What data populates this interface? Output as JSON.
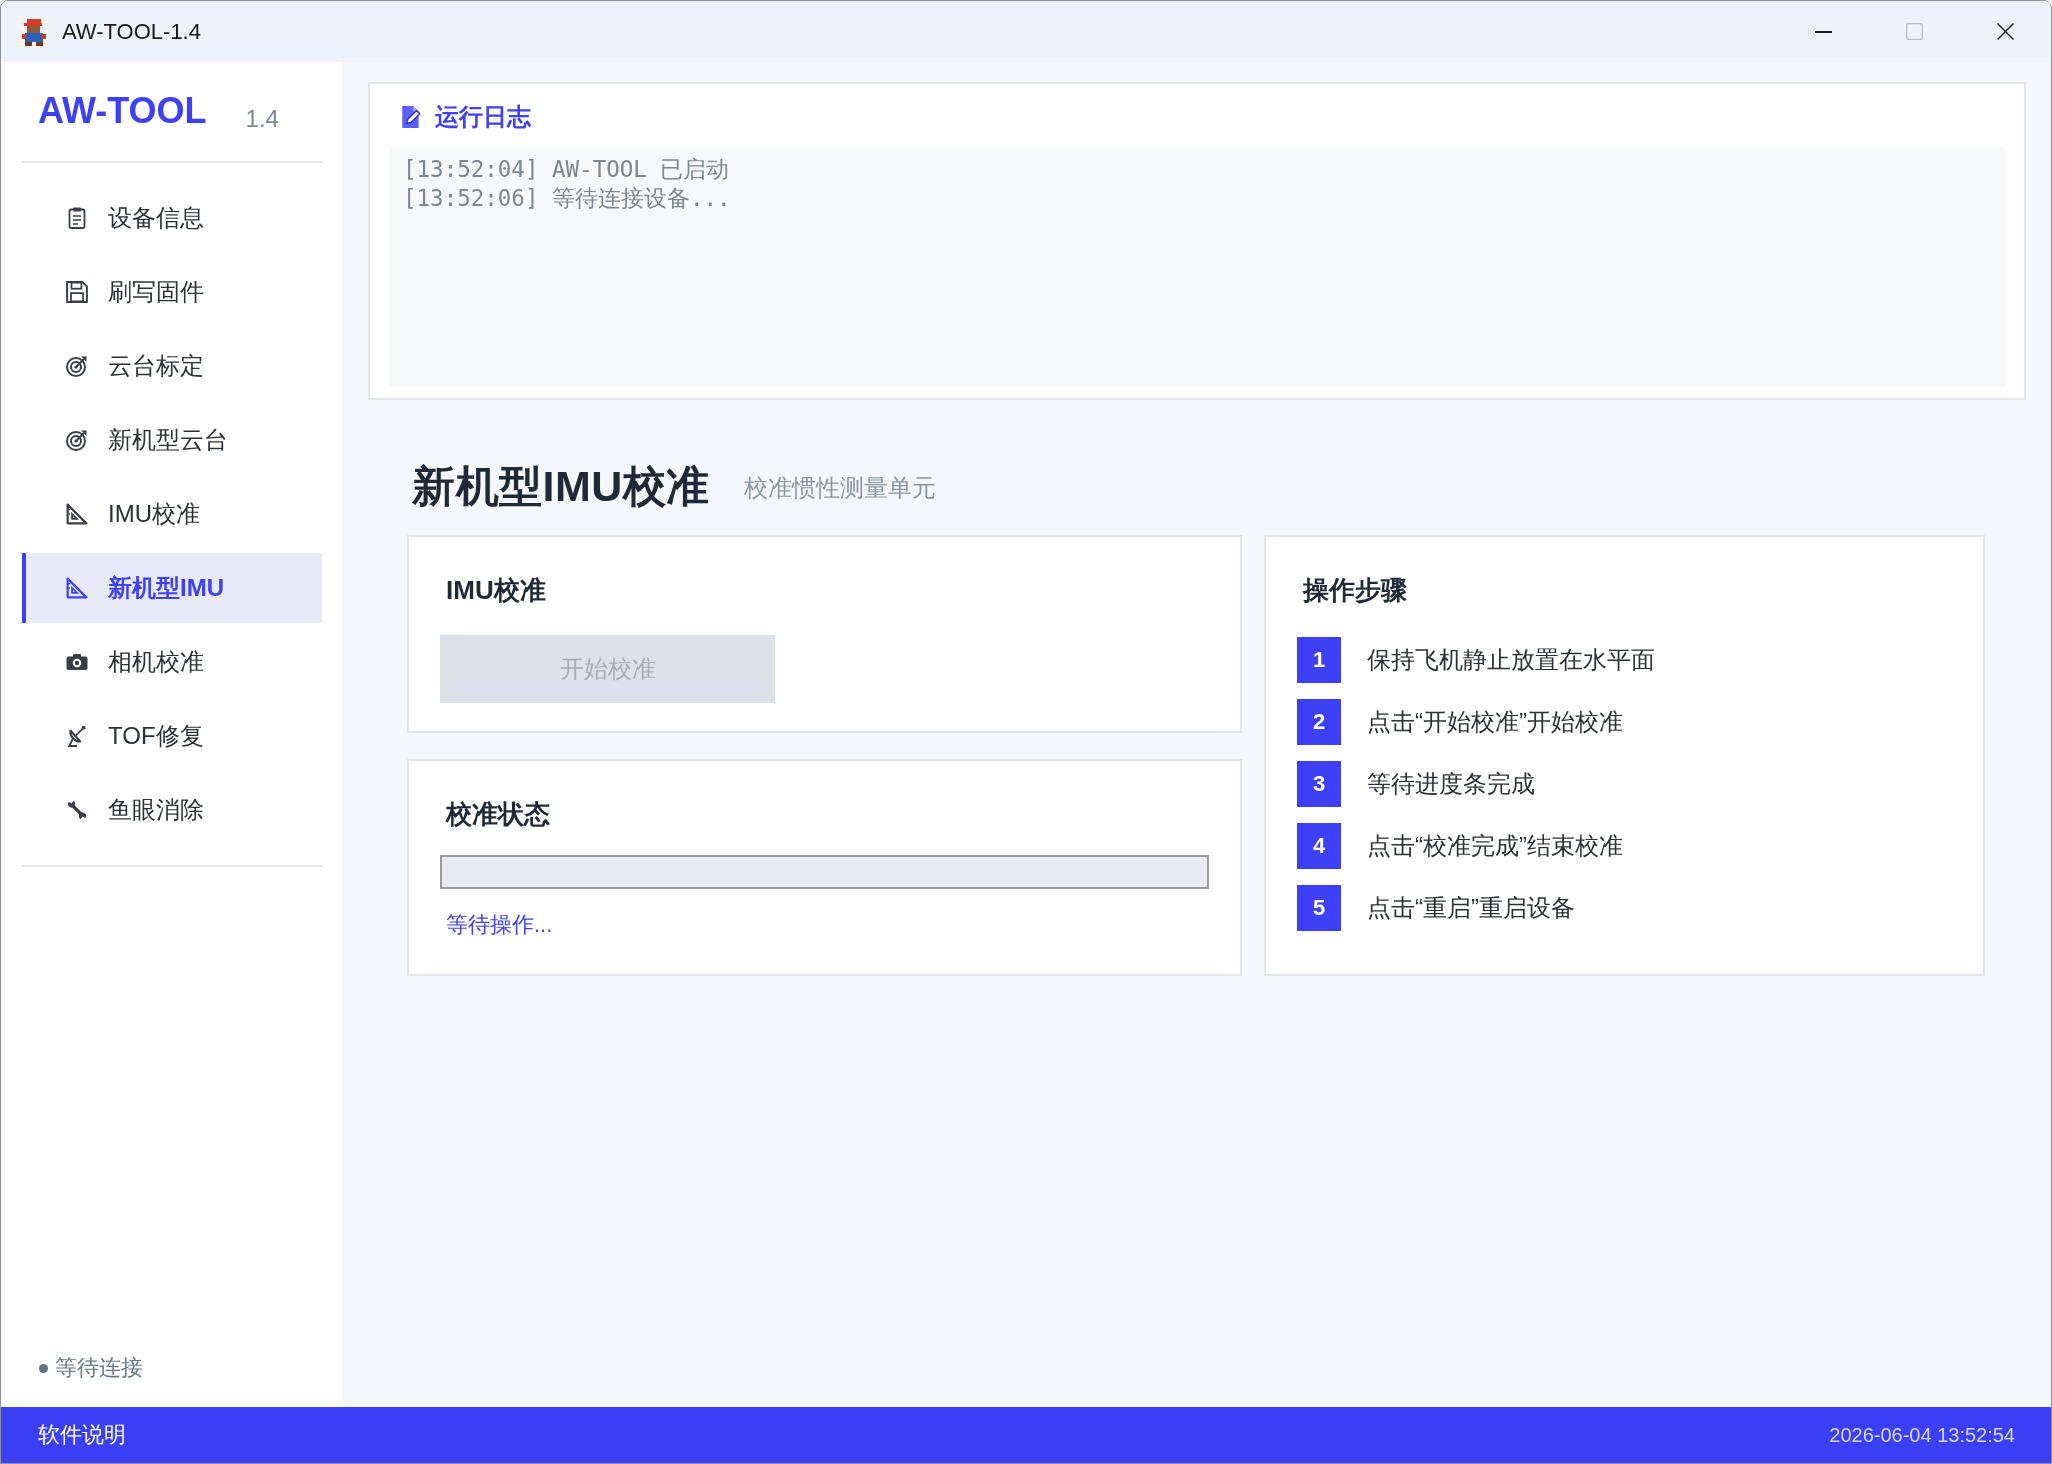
{
  "window": {
    "title": "AW-TOOL-1.4",
    "maximize_disabled": true
  },
  "sidebar": {
    "logo": "AW-TOOL",
    "version": "1.4",
    "items": [
      {
        "label": "设备信息",
        "selected": false
      },
      {
        "label": "刷写固件",
        "selected": false
      },
      {
        "label": "云台标定",
        "selected": false
      },
      {
        "label": "新机型云台",
        "selected": false
      },
      {
        "label": "IMU校准",
        "selected": false
      },
      {
        "label": "新机型IMU",
        "selected": true
      },
      {
        "label": "相机校准",
        "selected": false
      },
      {
        "label": "TOF修复",
        "selected": false
      },
      {
        "label": "鱼眼消除",
        "selected": false
      }
    ],
    "connection_status": "等待连接"
  },
  "log_panel": {
    "title": "运行日志",
    "lines": [
      "[13:52:04] AW-TOOL 已启动",
      "[13:52:06] 等待连接设备..."
    ]
  },
  "page": {
    "title": "新机型IMU校准",
    "subtitle": "校准惯性测量单元"
  },
  "calibration_card": {
    "title": "IMU校准",
    "button": {
      "label": "开始校准",
      "disabled": true
    }
  },
  "status_card": {
    "title": "校准状态",
    "progress": {
      "level": 0
    },
    "message": "等待操作..."
  },
  "steps_card": {
    "title": "操作步骤",
    "steps": [
      {
        "number": "1",
        "text": "保持飞机静止放置在水平面"
      },
      {
        "number": "2",
        "text": "点击“开始校准”开始校准"
      },
      {
        "number": "3",
        "text": "等待进度条完成"
      },
      {
        "number": "4",
        "text": "点击“校准完成”结束校准"
      },
      {
        "number": "5",
        "text": "点击“重启”重启设备"
      }
    ]
  },
  "status_bar": {
    "left": "软件说明",
    "datetime": "2026-06-04 13:52:54"
  }
}
